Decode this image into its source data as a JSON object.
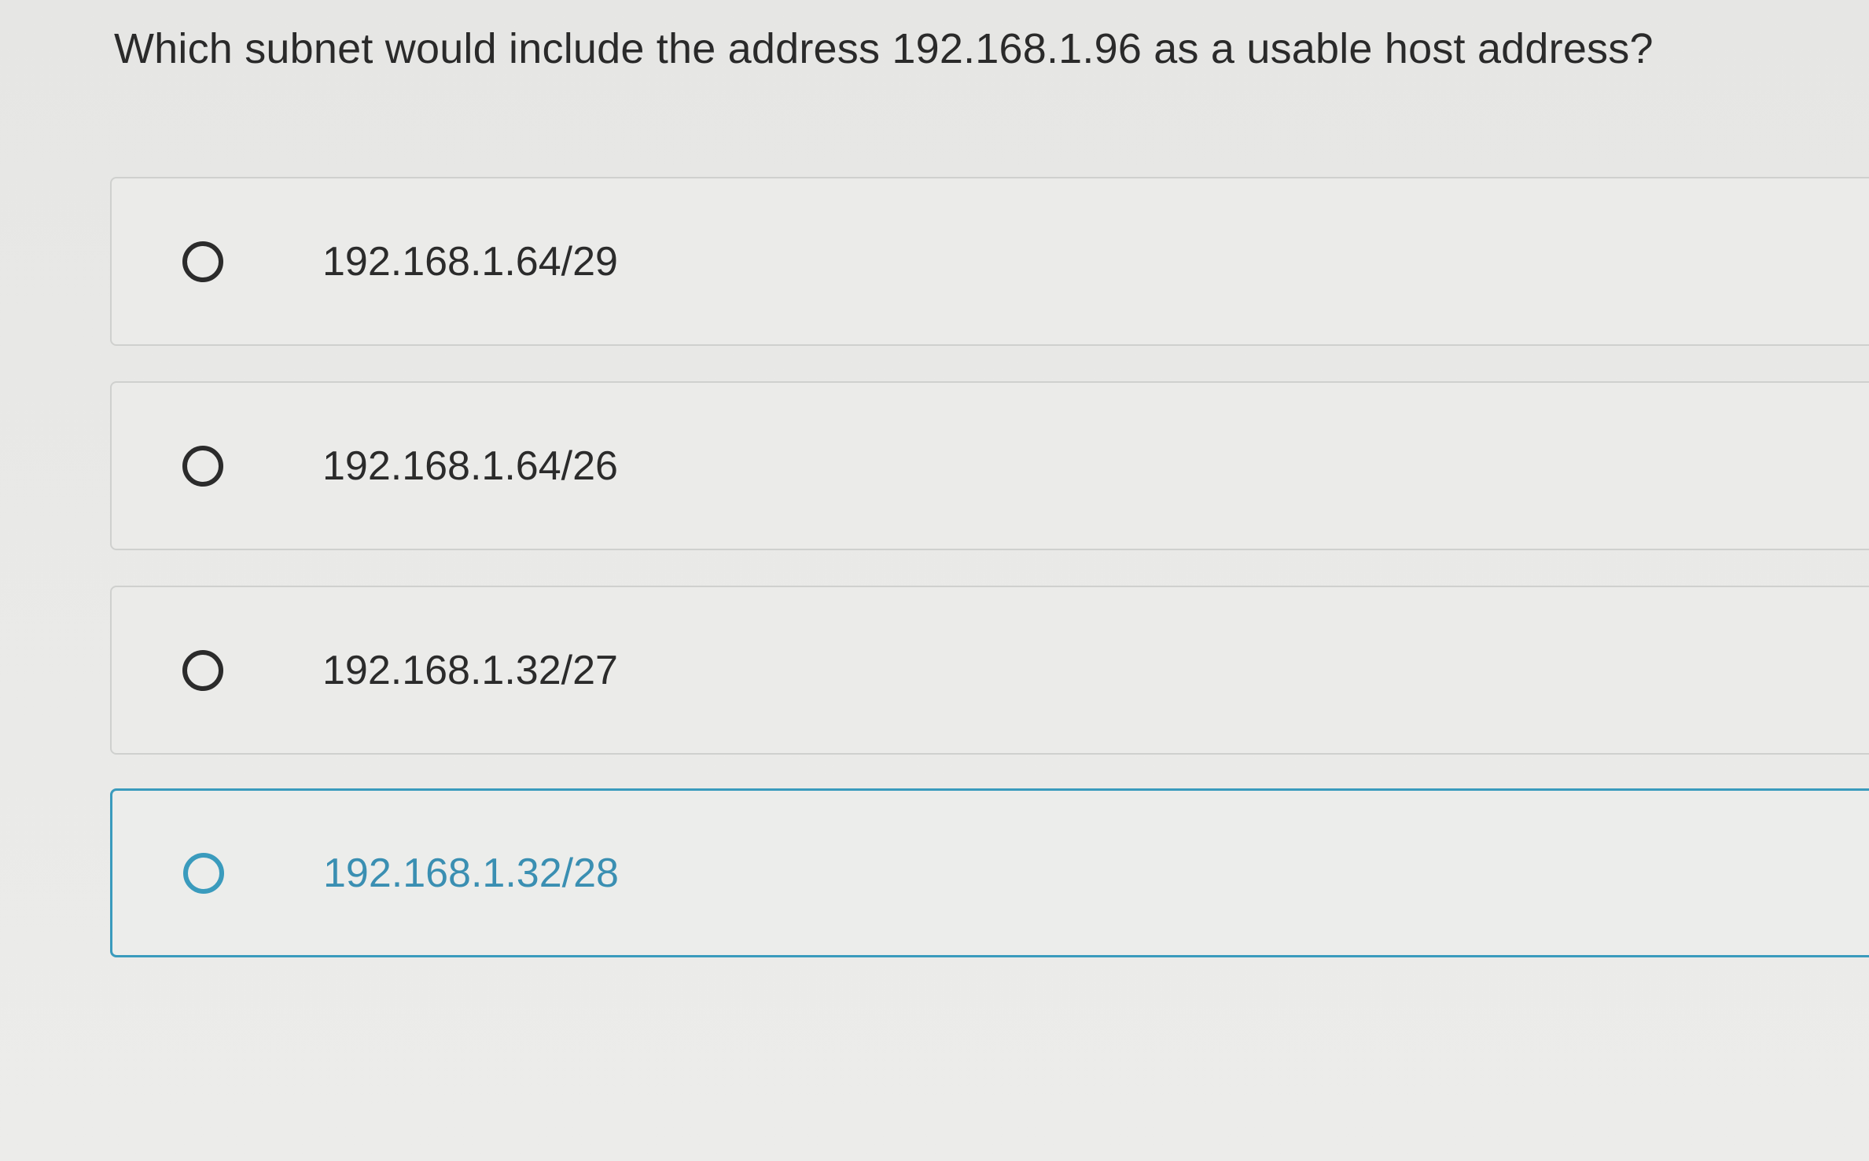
{
  "question": {
    "text": "Which subnet would include the address 192.168.1.96 as a usable host address?"
  },
  "options": [
    {
      "label": "192.168.1.64/29",
      "selected": false
    },
    {
      "label": "192.168.1.64/26",
      "selected": false
    },
    {
      "label": "192.168.1.32/27",
      "selected": false
    },
    {
      "label": "192.168.1.32/28",
      "selected": false,
      "highlighted": true
    }
  ],
  "colors": {
    "accent": "#3a9bbd",
    "text": "#2b2b2b",
    "border": "#cfd0ce",
    "background": "#e9e9e7"
  },
  "icons": {
    "radio": "radio-unchecked-icon"
  }
}
